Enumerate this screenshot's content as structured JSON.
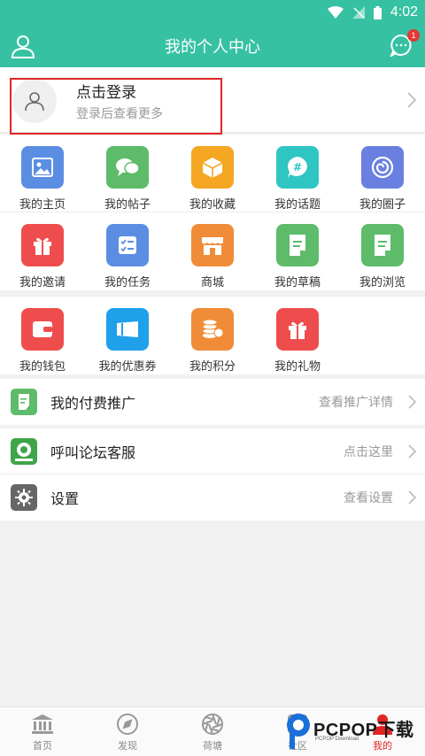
{
  "status_bar": {
    "time": "4:02"
  },
  "header": {
    "title": "我的个人中心",
    "badge_count": "1"
  },
  "login": {
    "title": "点击登录",
    "subtitle": "登录后查看更多"
  },
  "grid": {
    "row1": [
      {
        "label": "我的主页",
        "icon": "image-icon",
        "color": "#5b8ee3"
      },
      {
        "label": "我的帖子",
        "icon": "chat-bubbles-icon",
        "color": "#5dbb6a"
      },
      {
        "label": "我的收藏",
        "icon": "cube-icon",
        "color": "#f5a623"
      },
      {
        "label": "我的话题",
        "icon": "hashtag-icon",
        "color": "#2fc5c2"
      },
      {
        "label": "我的圈子",
        "icon": "circle-swirl-icon",
        "color": "#6a80e0"
      }
    ],
    "row2": [
      {
        "label": "我的邀请",
        "icon": "gift-icon",
        "color": "#ef4d4d"
      },
      {
        "label": "我的任务",
        "icon": "checklist-icon",
        "color": "#5b8ee3"
      },
      {
        "label": "商城",
        "icon": "store-icon",
        "color": "#f08c37"
      },
      {
        "label": "我的草稿",
        "icon": "document-icon",
        "color": "#5dbb6a"
      },
      {
        "label": "我的浏览",
        "icon": "document-icon",
        "color": "#5dbb6a"
      }
    ],
    "row3": [
      {
        "label": "我的钱包",
        "icon": "wallet-icon",
        "color": "#ef4d4d"
      },
      {
        "label": "我的优惠券",
        "icon": "coupon-icon",
        "color": "#1fa0ea"
      },
      {
        "label": "我的积分",
        "icon": "coins-icon",
        "color": "#f08c37"
      },
      {
        "label": "我的礼物",
        "icon": "gift-icon",
        "color": "#ef4d4d"
      }
    ]
  },
  "list": [
    {
      "label": "我的付费推广",
      "right": "查看推广详情",
      "icon": "document-icon",
      "color": "#5dbb6a"
    },
    {
      "label": "呼叫论坛客服",
      "right": "点击这里",
      "icon": "forum-logo-icon",
      "color": "#3fa54a"
    },
    {
      "label": "设置",
      "right": "查看设置",
      "icon": "gear-icon",
      "color": "#666666"
    }
  ],
  "bottom_nav": [
    {
      "label": "首页",
      "icon": "bank-icon",
      "active": false
    },
    {
      "label": "发现",
      "icon": "compass-icon",
      "active": false
    },
    {
      "label": "荷塘",
      "icon": "aperture-icon",
      "active": false
    },
    {
      "label": "社区",
      "icon": "community-icon",
      "active": false
    },
    {
      "label": "我的",
      "icon": "user-icon",
      "active": true
    }
  ],
  "watermark": {
    "text": "PCPOP下载",
    "sub": "PCPOP Download"
  }
}
